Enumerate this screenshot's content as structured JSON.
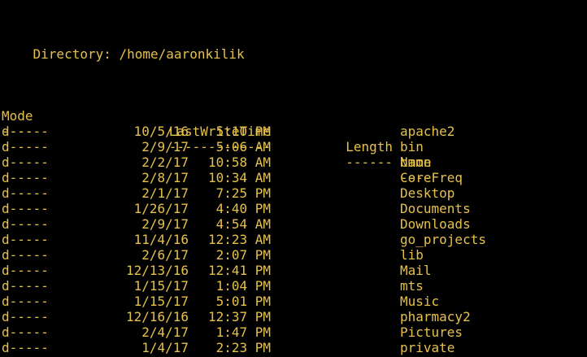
{
  "directory_line": "    Directory: /home/aaronkilik",
  "headers": {
    "mode": "Mode",
    "lastwritetime": "LastWriteTime",
    "length": "Length",
    "name": "Name"
  },
  "rules": {
    "mode": "----",
    "lastwritetime": "-------------",
    "length": "------",
    "name": "----"
  },
  "rows": [
    {
      "mode": "d-----",
      "date": "10/5/16",
      "time": "5:10 PM",
      "length": "",
      "name": "apache2"
    },
    {
      "mode": "d-----",
      "date": "2/9/17",
      "time": "5:06 AM",
      "length": "",
      "name": "bin"
    },
    {
      "mode": "d-----",
      "date": "2/2/17",
      "time": "10:58 AM",
      "length": "",
      "name": "bmon"
    },
    {
      "mode": "d-----",
      "date": "2/8/17",
      "time": "10:34 AM",
      "length": "",
      "name": "CoreFreq"
    },
    {
      "mode": "d-----",
      "date": "2/1/17",
      "time": "7:25 PM",
      "length": "",
      "name": "Desktop"
    },
    {
      "mode": "d-----",
      "date": "1/26/17",
      "time": "4:40 PM",
      "length": "",
      "name": "Documents"
    },
    {
      "mode": "d-----",
      "date": "2/9/17",
      "time": "4:54 AM",
      "length": "",
      "name": "Downloads"
    },
    {
      "mode": "d-----",
      "date": "11/4/16",
      "time": "12:23 AM",
      "length": "",
      "name": "go_projects"
    },
    {
      "mode": "d-----",
      "date": "2/6/17",
      "time": "2:07 PM",
      "length": "",
      "name": "lib"
    },
    {
      "mode": "d-----",
      "date": "12/13/16",
      "time": "12:41 PM",
      "length": "",
      "name": "Mail"
    },
    {
      "mode": "d-----",
      "date": "1/15/17",
      "time": "1:04 PM",
      "length": "",
      "name": "mts"
    },
    {
      "mode": "d-----",
      "date": "1/15/17",
      "time": "5:01 PM",
      "length": "",
      "name": "Music"
    },
    {
      "mode": "d-----",
      "date": "12/16/16",
      "time": "12:37 PM",
      "length": "",
      "name": "pharmacy2"
    },
    {
      "mode": "d-----",
      "date": "2/4/17",
      "time": "1:47 PM",
      "length": "",
      "name": "Pictures"
    },
    {
      "mode": "d-----",
      "date": "1/4/17",
      "time": "2:23 PM",
      "length": "",
      "name": "private"
    }
  ],
  "colors": {
    "background": "#000000",
    "text": "#e6c14a"
  }
}
